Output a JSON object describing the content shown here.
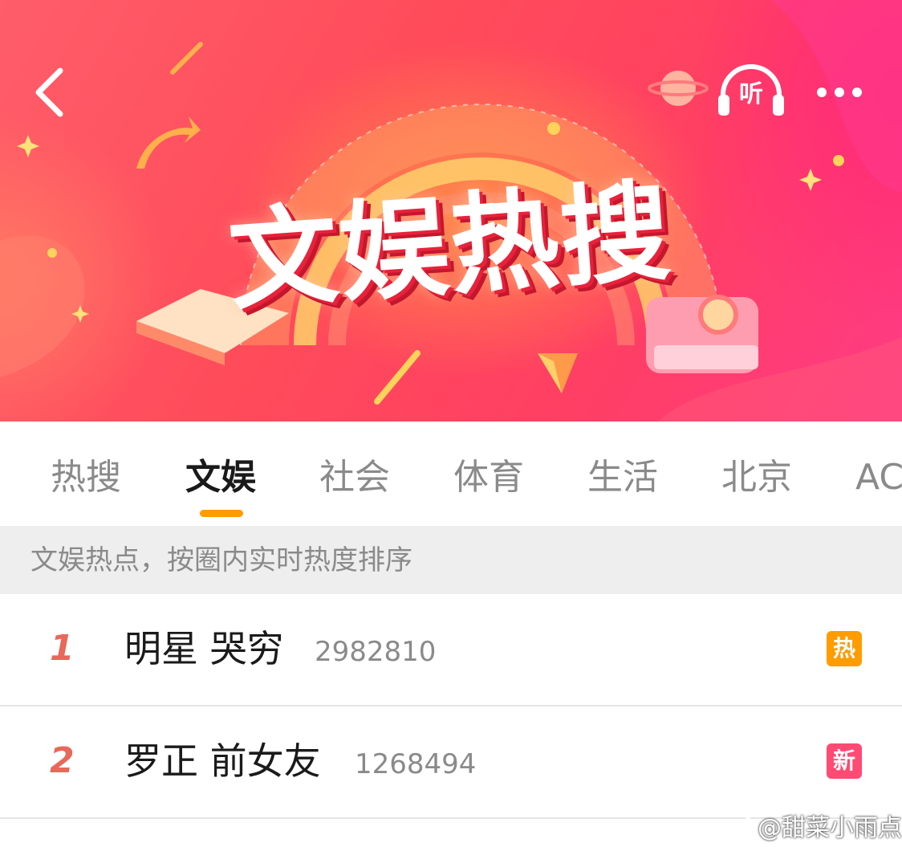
{
  "banner": {
    "title": "文娱热搜",
    "listen_label": "听",
    "icons": {
      "back": "chevron-left-icon",
      "listen": "headphones-icon",
      "more": "more-dots-icon"
    },
    "colors": {
      "primary": "#ff4b5a",
      "accent": "#ff9c00"
    }
  },
  "tabs": [
    {
      "label": "热搜",
      "active": false
    },
    {
      "label": "文娱",
      "active": true
    },
    {
      "label": "社会",
      "active": false
    },
    {
      "label": "体育",
      "active": false
    },
    {
      "label": "生活",
      "active": false
    },
    {
      "label": "北京",
      "active": false
    },
    {
      "label": "AC",
      "active": false
    }
  ],
  "info": {
    "text": "文娱热点，按圈内实时热度排序"
  },
  "list": [
    {
      "rank": "1",
      "topic": "明星 哭穷",
      "heat": "2982810",
      "badge": "热",
      "badge_color": "#ff9c00"
    },
    {
      "rank": "2",
      "topic": "罗正 前女友",
      "heat": "1268494",
      "badge": "新",
      "badge_color": "#ff4a74"
    }
  ],
  "watermark": {
    "text": "@甜菜小雨点"
  }
}
